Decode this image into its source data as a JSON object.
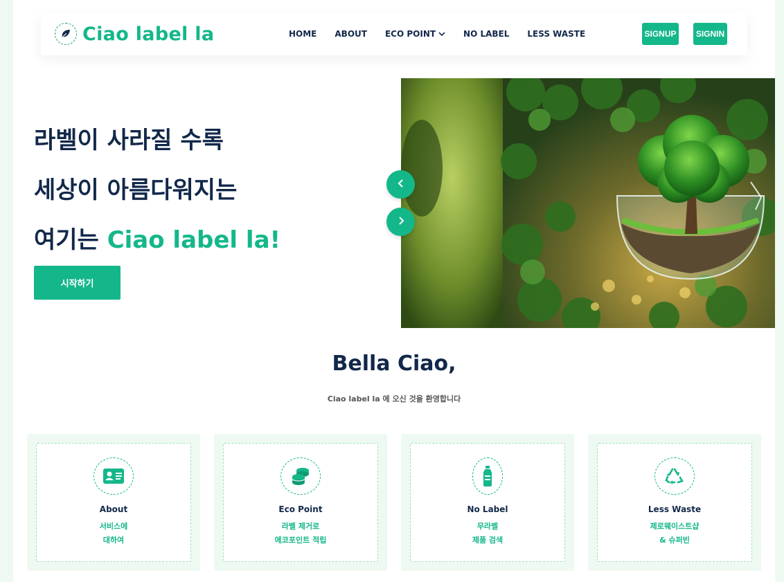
{
  "brand": {
    "name": "Ciao label la"
  },
  "nav": {
    "items": [
      {
        "label": "HOME"
      },
      {
        "label": "ABOUT"
      },
      {
        "label": "ECO POINT"
      },
      {
        "label": "NO LABEL"
      },
      {
        "label": "LESS WASTE"
      }
    ],
    "signup": "SIGNUP",
    "signin": "SIGNIN"
  },
  "hero": {
    "line1": "라벨이 사라질 수록",
    "line2": "세상이 아름다워지는",
    "line3_prefix": "여기는 ",
    "line3_accent": "Ciao label la!",
    "cta": "시작하기"
  },
  "welcome": {
    "title": "Bella Ciao,",
    "subtitle": "Ciao label la 에 오신 것을 환영합니다"
  },
  "cards": [
    {
      "icon": "id-card-icon",
      "title": "About",
      "desc1": "서비스에",
      "desc2": "대하여"
    },
    {
      "icon": "coins-icon",
      "title": "Eco Point",
      "desc1": "라벨 제거로",
      "desc2": "에코포인트 적립"
    },
    {
      "icon": "bottle-icon",
      "title": "No Label",
      "desc1": "무라벨",
      "desc2": "제품 검색"
    },
    {
      "icon": "recycle-icon",
      "title": "Less Waste",
      "desc1": "제로웨이스트샵",
      "desc2": "& 슈퍼빈"
    }
  ],
  "colors": {
    "accent": "#14b78a",
    "text": "#12284a",
    "background": "#eefaf1"
  }
}
